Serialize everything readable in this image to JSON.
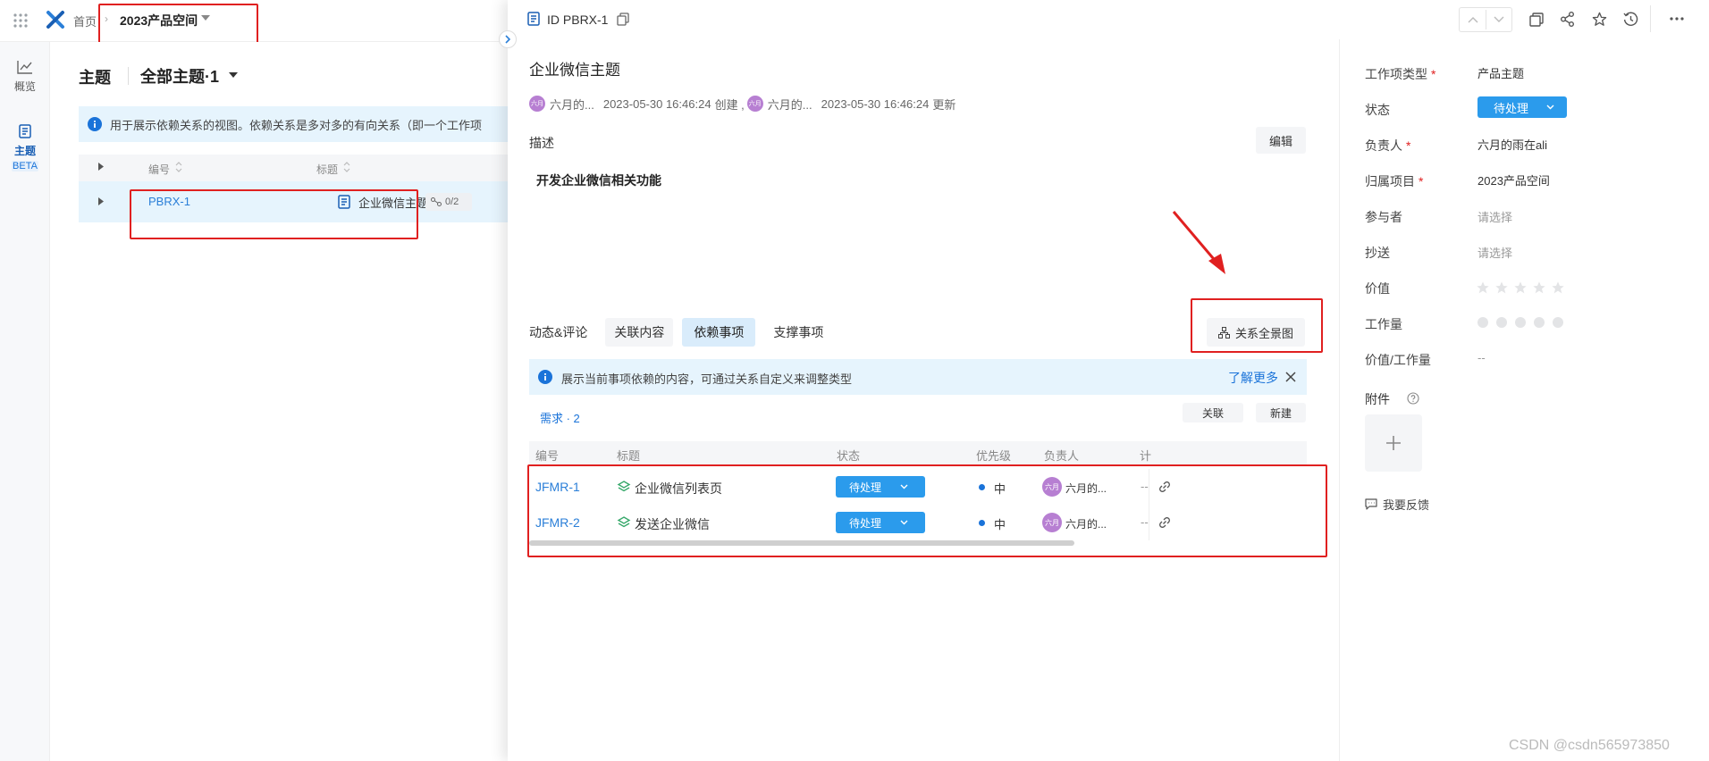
{
  "topbar": {
    "home_label": "首页",
    "project_label": "2023产品空间"
  },
  "rail": {
    "items": [
      {
        "label": "概览"
      },
      {
        "label": "主题",
        "badge": "BETA"
      }
    ]
  },
  "main": {
    "title": "主题",
    "view_label": "全部主题·1",
    "info_text": "用于展示依赖关系的视图。依赖关系是多对多的有向关系（即一个工作项",
    "table": {
      "headers": [
        "编号",
        "标题"
      ],
      "rows": [
        {
          "id": "PBRX-1",
          "title": "企业微信主题",
          "badge": "0/2"
        }
      ]
    }
  },
  "drawer": {
    "id_label": "ID PBRX-1",
    "title": "企业微信主题",
    "meta": {
      "creator": "六月的...",
      "created_at": "2023-05-30 16:46:24",
      "created_word": "创建 ,",
      "updater": "六月的...",
      "updated_at": "2023-05-30 16:46:24",
      "updated_word": "更新",
      "avatar_text": "六月"
    },
    "description": {
      "label": "描述",
      "edit_label": "编辑",
      "content": "开发企业微信相关功能"
    },
    "tabs": [
      {
        "label": "动态&评论"
      },
      {
        "label": "关联内容"
      },
      {
        "label": "依赖事项",
        "active": true
      },
      {
        "label": "支撑事项"
      }
    ],
    "relation_button": "关系全景图",
    "notice": {
      "text": "展示当前事项依赖的内容，可通过关系自定义来调整类型",
      "link": "了解更多"
    },
    "section": {
      "label": "需求 · 2",
      "link_button": "关联",
      "new_button": "新建"
    },
    "table": {
      "headers": [
        "编号",
        "标题",
        "状态",
        "优先级",
        "负责人",
        "计"
      ],
      "rows": [
        {
          "id": "JFMR-1",
          "title": "企业微信列表页",
          "status": "待处理",
          "priority": "中",
          "owner": "六月的...",
          "plan": "--"
        },
        {
          "id": "JFMR-2",
          "title": "发送企业微信",
          "status": "待处理",
          "priority": "中",
          "owner": "六月的...",
          "plan": "--"
        }
      ]
    }
  },
  "side": {
    "fields": [
      {
        "label": "工作项类型",
        "required": true,
        "value": "产品主题"
      },
      {
        "label": "状态",
        "required": false,
        "value": "待处理"
      },
      {
        "label": "负责人",
        "required": true,
        "value": "六月的雨在ali"
      },
      {
        "label": "归属项目",
        "required": true,
        "value": "2023产品空间"
      },
      {
        "label": "参与者",
        "required": false,
        "value": "请选择"
      },
      {
        "label": "抄送",
        "required": false,
        "value": "请选择"
      },
      {
        "label": "价值",
        "required": false,
        "value": ""
      },
      {
        "label": "工作量",
        "required": false,
        "value": ""
      },
      {
        "label": "价值/工作量",
        "required": false,
        "value": "--"
      }
    ],
    "value_stars": 0,
    "effort_dots": 0,
    "attachment_label": "附件",
    "feedback_label": "我要反馈"
  },
  "watermark": "CSDN @csdn565973850",
  "colors": {
    "primary": "#2b9bec",
    "link": "#2b7fd8",
    "annotation": "#e02020",
    "avatar": "#b77fd2",
    "info_bg": "#e6f4fd"
  }
}
